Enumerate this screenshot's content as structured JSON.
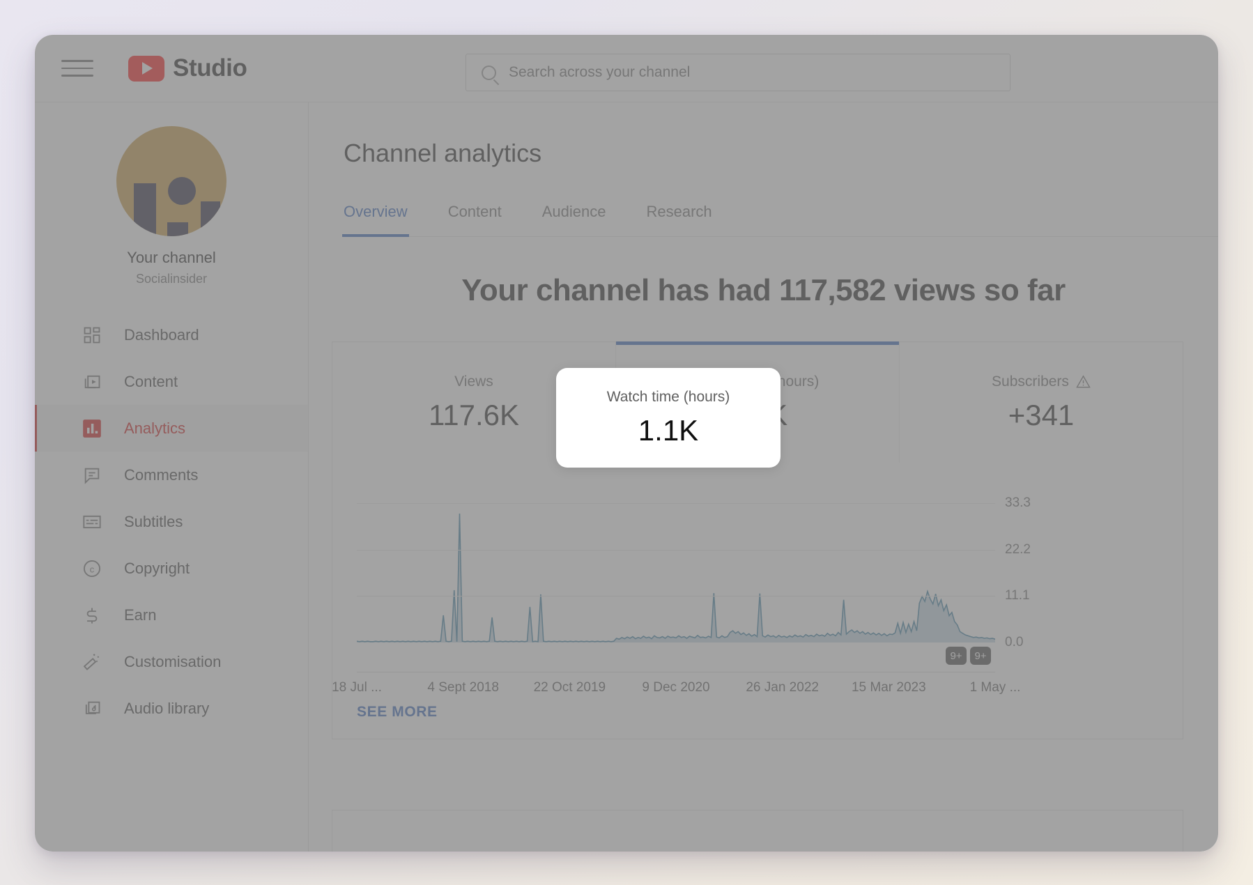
{
  "app": {
    "brand": "Studio",
    "logo_color": "#ff0000"
  },
  "topbar": {
    "menu_icon": "hamburger-icon",
    "search": {
      "placeholder": "Search across your channel",
      "value": "",
      "icon": "search-icon"
    }
  },
  "sidebar": {
    "channel_label": "Your channel",
    "channel_name": "Socialinsider",
    "avatar_color": "#c09032",
    "items": [
      {
        "label": "Dashboard",
        "icon": "dashboard-icon",
        "active": false
      },
      {
        "label": "Content",
        "icon": "content-icon",
        "active": false
      },
      {
        "label": "Analytics",
        "icon": "analytics-icon",
        "active": true
      },
      {
        "label": "Comments",
        "icon": "comments-icon",
        "active": false
      },
      {
        "label": "Subtitles",
        "icon": "subtitles-icon",
        "active": false
      },
      {
        "label": "Copyright",
        "icon": "copyright-icon",
        "active": false
      },
      {
        "label": "Earn",
        "icon": "earn-icon",
        "active": false
      },
      {
        "label": "Customisation",
        "icon": "customisation-icon",
        "active": false
      },
      {
        "label": "Audio library",
        "icon": "audio-library-icon",
        "active": false
      }
    ],
    "active_color": "#cc0000"
  },
  "main": {
    "page_title": "Channel analytics",
    "tabs": [
      {
        "label": "Overview",
        "active": true
      },
      {
        "label": "Content",
        "active": false
      },
      {
        "label": "Audience",
        "active": false
      },
      {
        "label": "Research",
        "active": false
      }
    ],
    "accent_color": "#2156b5",
    "headline": "Your channel has had 117,582 views so far",
    "metrics": [
      {
        "label": "Views",
        "value": "117.6K",
        "selected": false,
        "warning": false
      },
      {
        "label": "Watch time (hours)",
        "value": "1.1K",
        "selected": true,
        "warning": false
      },
      {
        "label": "Subscribers",
        "value": "+341",
        "selected": false,
        "warning": true
      }
    ],
    "see_more": "SEE MORE",
    "chart_badges": [
      "9+",
      "9+"
    ]
  },
  "chart_data": {
    "type": "area",
    "title": "",
    "xlabel": "",
    "ylabel": "",
    "line_color": "#2a7599",
    "grid": true,
    "ylim": [
      0.0,
      33.3
    ],
    "yticks": [
      "33.3",
      "22.2",
      "11.1",
      "0.0"
    ],
    "ytick_values": [
      33.3,
      22.2,
      11.1,
      0.0
    ],
    "xticks": [
      "18 Jul ...",
      "4 Sept 2018",
      "22 Oct 2019",
      "9 Dec 2020",
      "26 Jan 2022",
      "15 Mar 2023",
      "1 May ..."
    ],
    "series": [
      {
        "name": "Watch time (hours)",
        "values": [
          0.3,
          0.2,
          0.3,
          0.2,
          0.3,
          0.2,
          0.2,
          0.3,
          0.2,
          0.3,
          0.2,
          0.3,
          0.2,
          0.3,
          0.2,
          0.3,
          0.2,
          0.3,
          0.2,
          0.3,
          0.2,
          0.3,
          0.2,
          0.3,
          0.2,
          0.3,
          0.2,
          0.3,
          0.2,
          0.3,
          0.2,
          0.3,
          6.5,
          0.3,
          0.2,
          0.3,
          12.5,
          0.2,
          30.8,
          0.3,
          0.2,
          0.3,
          0.2,
          0.3,
          0.2,
          0.3,
          0.2,
          0.3,
          0.2,
          0.3,
          6.0,
          0.3,
          0.2,
          0.3,
          0.2,
          0.3,
          0.2,
          0.3,
          0.2,
          0.3,
          0.2,
          0.3,
          0.2,
          0.3,
          8.5,
          0.2,
          0.3,
          0.2,
          11.5,
          0.3,
          0.2,
          0.3,
          0.2,
          0.3,
          0.2,
          0.3,
          0.2,
          0.3,
          0.2,
          0.3,
          0.2,
          0.3,
          0.2,
          0.3,
          0.2,
          0.3,
          0.2,
          0.3,
          0.2,
          0.3,
          0.2,
          0.3,
          0.2,
          0.3,
          0.2,
          0.3,
          1.0,
          0.8,
          1.2,
          0.9,
          1.3,
          1.0,
          1.4,
          0.9,
          1.2,
          1.0,
          1.5,
          1.1,
          1.3,
          0.9,
          1.6,
          1.2,
          1.1,
          1.4,
          1.0,
          1.5,
          1.2,
          1.3,
          1.1,
          1.6,
          1.2,
          1.4,
          1.0,
          1.5,
          1.3,
          1.1,
          1.7,
          1.2,
          1.3,
          1.1,
          1.5,
          1.2,
          11.8,
          1.3,
          1.1,
          1.6,
          1.2,
          1.4,
          2.4,
          2.8,
          2.2,
          2.6,
          1.9,
          2.3,
          1.7,
          2.1,
          1.5,
          1.9,
          1.4,
          11.7,
          1.6,
          1.3,
          1.8,
          1.4,
          1.6,
          1.2,
          1.7,
          1.3,
          1.5,
          1.2,
          1.6,
          1.3,
          1.8,
          1.4,
          1.6,
          1.3,
          1.9,
          1.5,
          1.7,
          1.4,
          2.0,
          1.6,
          1.8,
          1.5,
          2.2,
          1.7,
          2.0,
          1.6,
          2.4,
          1.8,
          10.2,
          2.0,
          2.6,
          3.0,
          2.4,
          2.8,
          2.2,
          2.6,
          2.0,
          2.4,
          1.9,
          2.3,
          1.8,
          2.2,
          1.7,
          2.1,
          1.6,
          2.0,
          1.9,
          2.3,
          4.6,
          2.2,
          4.8,
          2.4,
          4.4,
          2.6,
          5.0,
          2.8,
          9.4,
          11.0,
          9.8,
          12.2,
          10.4,
          9.2,
          11.6,
          8.8,
          10.2,
          7.6,
          9.0,
          6.4,
          7.2,
          5.0,
          4.2,
          2.6,
          2.2,
          1.8,
          1.6,
          1.4,
          1.2,
          1.3,
          1.1,
          1.2,
          1.0,
          1.1,
          0.9,
          1.0,
          0.8
        ]
      }
    ]
  }
}
